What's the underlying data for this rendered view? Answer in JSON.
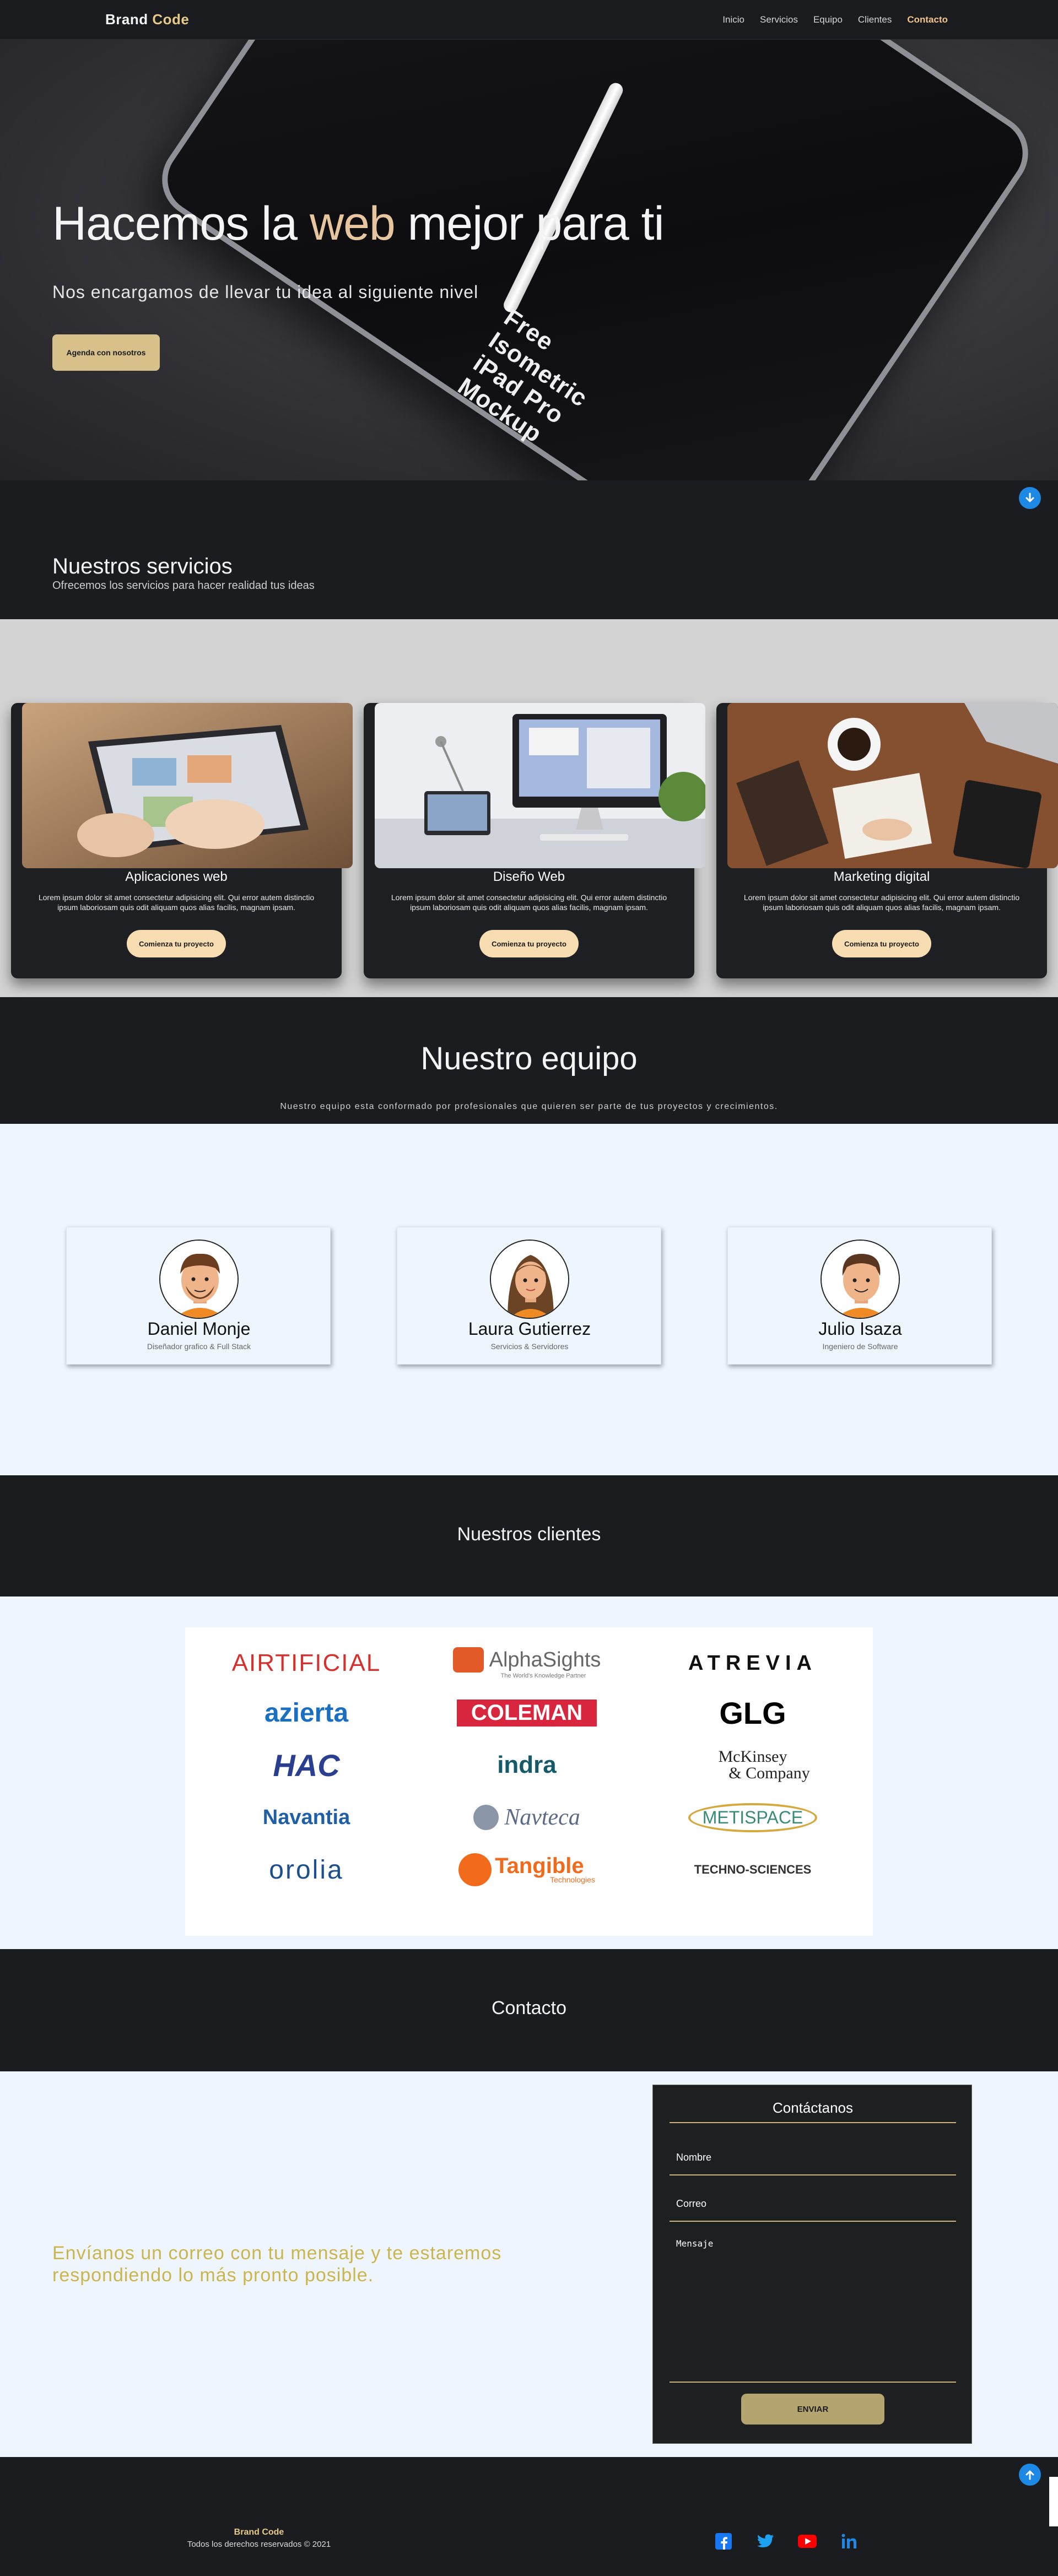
{
  "nav": {
    "brand_part1": "Brand",
    "brand_part2": "Code",
    "links": [
      "Inicio",
      "Servicios",
      "Equipo",
      "Clientes",
      "Contacto"
    ]
  },
  "hero": {
    "title_part1": "Hacemos la",
    "title_accent": "web",
    "title_part2": "mejor para ti",
    "subtitle": "Nos encargamos de llevar tu idea al siguiente nivel",
    "cta": "Agenda con nosotros",
    "mockup_line1": "Free",
    "mockup_line2": "Isometric",
    "mockup_line3": "iPad Pro",
    "mockup_line4": "Mockup"
  },
  "services": {
    "title": "Nuestros servicios",
    "subtitle": "Ofrecemos los servicios para hacer realidad tus ideas",
    "cards": [
      {
        "title": "Aplicaciones web",
        "text": "Lorem ipsum dolor sit amet consectetur adipisicing elit. Qui error autem distinctio ipsum laboriosam quis odit aliquam quos alias facilis, magnam ipsam.",
        "button": "Comienza tu proyecto"
      },
      {
        "title": "Diseño Web",
        "text": "Lorem ipsum dolor sit amet consectetur adipisicing elit. Qui error autem distinctio ipsum laboriosam quis odit aliquam quos alias facilis, magnam ipsam.",
        "button": "Comienza tu proyecto"
      },
      {
        "title": "Marketing digital",
        "text": "Lorem ipsum dolor sit amet consectetur adipisicing elit. Qui error autem distinctio ipsum laboriosam quis odit aliquam quos alias facilis, magnam ipsam.",
        "button": "Comienza tu proyecto"
      }
    ]
  },
  "team": {
    "title": "Nuestro equipo",
    "subtitle": "Nuestro equipo esta conformado por profesionales que quieren ser parte de tus proyectos y crecimientos.",
    "members": [
      {
        "name": "Daniel Monje",
        "role": "Diseñador grafico & Full Stack"
      },
      {
        "name": "Laura Gutierrez",
        "role": "Servicios & Servidores"
      },
      {
        "name": "Julio Isaza",
        "role": "Ingeniero de Software"
      }
    ]
  },
  "clients": {
    "title": "Nuestros clientes",
    "logos": [
      "AIRTIFICIAL",
      "AlphaSights",
      "The World's Knowledge Partner",
      "ATREVIA",
      "azierta",
      "COLEMAN",
      "GLG",
      "HAC",
      "indra",
      "McKinsey",
      "& Company",
      "Navantia",
      "Navteca",
      "METISPACE",
      "orolia",
      "Tangible",
      "Technologies",
      "TECHNO-SCIENCES"
    ]
  },
  "contact": {
    "title": "Contacto",
    "message": "Envíanos un correo con tu mensaje y te estaremos respondiendo lo más pronto posible.",
    "form_title": "Contáctanos",
    "name_placeholder": "Nombre",
    "email_placeholder": "Correo",
    "message_placeholder": "Mensaje",
    "send": "ENVIAR"
  },
  "footer": {
    "brand": "Brand Code",
    "copyright": "Todos los derechos reservados © 2021"
  },
  "icons": [
    "arrow-down-circle-icon",
    "arrow-up-circle-icon",
    "facebook-icon",
    "twitter-icon",
    "youtube-icon",
    "linkedin-icon"
  ],
  "colors": {
    "accent": "#e7c59e",
    "gold": "#d7c08a",
    "dark": "#1b1c20",
    "light": "#eef5fd",
    "blue": "#1e88e5"
  }
}
